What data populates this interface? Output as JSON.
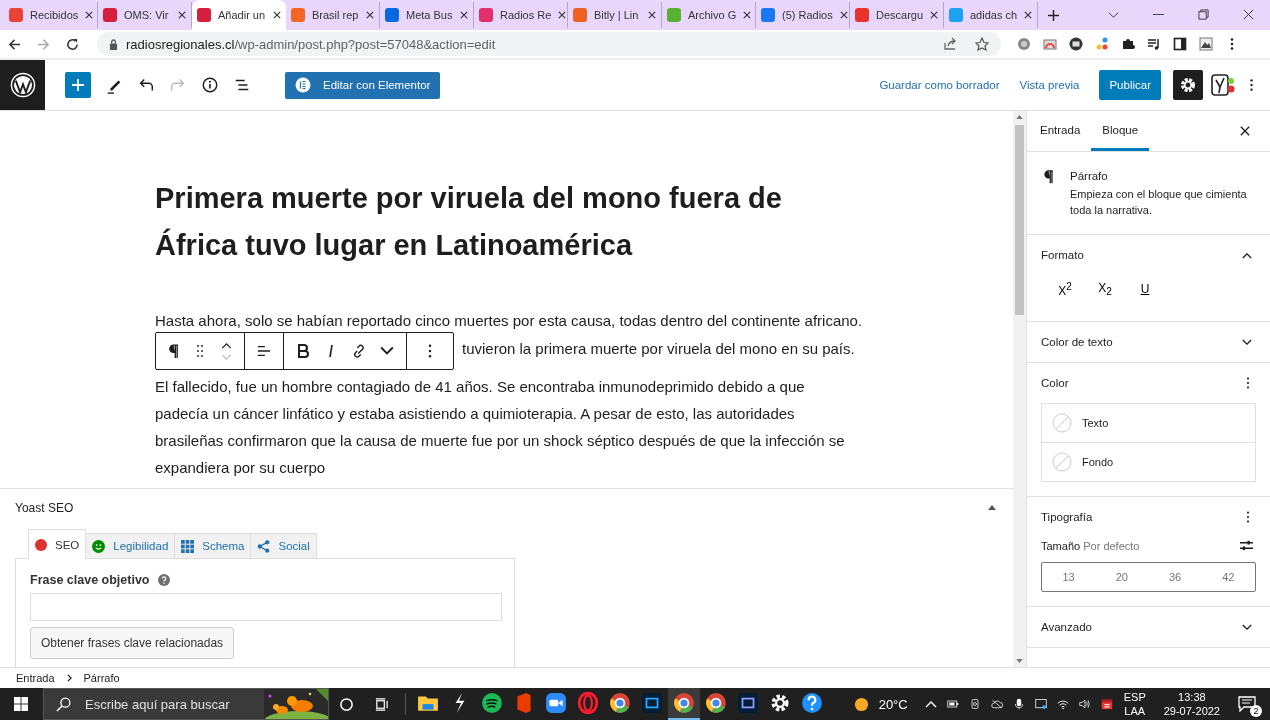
{
  "browser": {
    "tabs": [
      {
        "title": "Recibidos",
        "selected": false
      },
      {
        "title": "OMS: Vir",
        "selected": false
      },
      {
        "title": "Añadir un",
        "selected": true
      },
      {
        "title": "Brasil rep",
        "selected": false
      },
      {
        "title": "Meta Bus",
        "selected": false
      },
      {
        "title": "Radios Re",
        "selected": false
      },
      {
        "title": "Bitly | Lin",
        "selected": false
      },
      {
        "title": "Archivo G",
        "selected": false
      },
      {
        "title": "(5) Radios",
        "selected": false
      },
      {
        "title": "Descargu",
        "selected": false
      },
      {
        "title": "adidas ch",
        "selected": false
      }
    ],
    "address": {
      "host": "radiosregionales.cl",
      "path": "/wp-admin/post.php?post=57048&action=edit"
    }
  },
  "editor_header": {
    "elementor_button": "Editar con Elementor",
    "save_draft": "Guardar como borrador",
    "preview": "Vista previa",
    "publish": "Publicar",
    "settings_selected": true
  },
  "post": {
    "title": "Primera muerte por viruela del mono fuera de África tuvo lugar en Latinoamérica",
    "paragraph_1_lines": [
      "Hasta ahora, solo se habían reportado cinco muertes por esta causa, todas dentro del continente africano.",
      "tuvieron la primera muerte por viruela del mono en su país."
    ],
    "paragraph_2": "El fallecido, fue un hombre contagiado de 41 años. Se encontraba inmunodeprimido debido a que padecía un cáncer linfático  y estaba asistiendo a quimioterapia. A pesar de esto, las autoridades brasileñas confirmaron que la causa de muerte fue por un shock séptico después de que la infección se expandiera  por su cuerpo"
  },
  "yoast": {
    "heading": "Yoast SEO",
    "tabs": [
      {
        "label": "SEO",
        "selected": true,
        "kind": "seo",
        "color": "#dc3232"
      },
      {
        "label": "Legibilidad",
        "selected": false,
        "kind": "readability",
        "color": "#008a00"
      },
      {
        "label": "Schema",
        "selected": false,
        "kind": "schema"
      },
      {
        "label": "Social",
        "selected": false,
        "kind": "social"
      }
    ],
    "keyphrase_label": "Frase clave objetivo",
    "related_button": "Obtener frases clave relacionadas"
  },
  "breadcrumb": [
    "Entrada",
    "Párrafo"
  ],
  "sidebar": {
    "tabs": [
      {
        "label": "Entrada",
        "selected": false
      },
      {
        "label": "Bloque",
        "selected": true
      }
    ],
    "block": {
      "name": "Párrafo",
      "description": "Empieza con el bloque que cimienta toda la narrativa."
    },
    "sections": [
      {
        "kind": "format",
        "title": "Formato",
        "expanded": true,
        "tools": [
          {
            "label": "X$^{2}$",
            "kind": "superscript"
          },
          {
            "label": "X$_{2}$",
            "kind": "subscript"
          },
          {
            "label": "U",
            "kind": "underline"
          }
        ]
      },
      {
        "kind": "toggle",
        "title": "Color de texto",
        "expanded": false
      },
      {
        "kind": "color",
        "title": "Color",
        "items": [
          "Texto",
          "Fondo"
        ]
      },
      {
        "kind": "typography",
        "title": "Tipografía",
        "size_label": "Tamaño",
        "size_value": "Por defecto",
        "sizes": [
          "13",
          "20",
          "36",
          "42"
        ]
      },
      {
        "kind": "toggle",
        "title": "Avanzado",
        "expanded": false
      }
    ]
  },
  "taskbar": {
    "search_placeholder": "Escribe aquí para buscar",
    "temperature": "20°C",
    "language": "ESP",
    "layout": "LAA",
    "time": "13:38",
    "date": "29-07-2022",
    "notifications": "2"
  }
}
